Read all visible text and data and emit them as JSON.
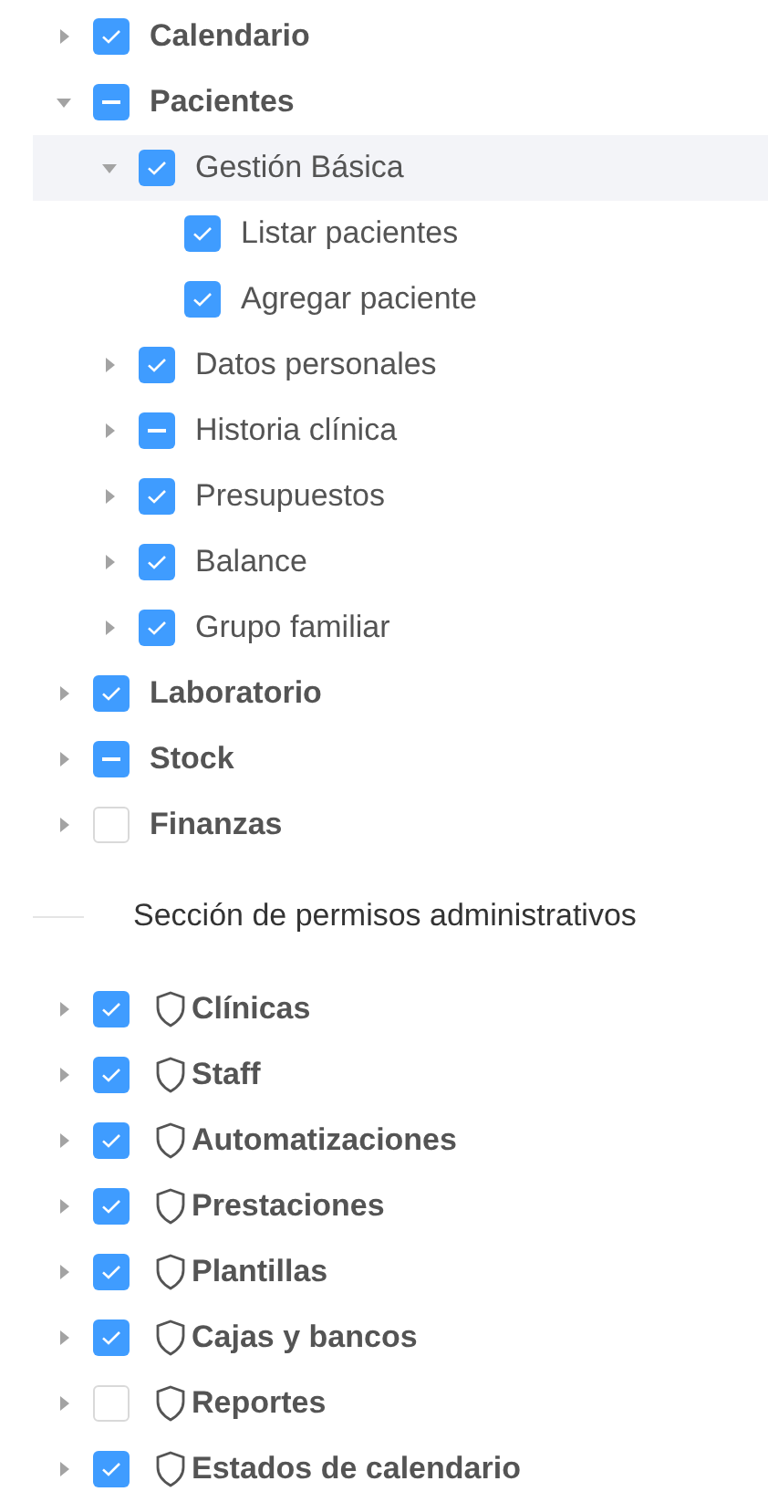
{
  "tree": [
    {
      "label": "Calendario",
      "checked": true,
      "partial": false,
      "expanded": false,
      "selected": false
    },
    {
      "label": "Pacientes",
      "checked": true,
      "partial": true,
      "expanded": true,
      "selected": false,
      "children": [
        {
          "label": "Gestión Básica",
          "checked": true,
          "partial": false,
          "expanded": true,
          "selected": true,
          "children": [
            {
              "label": "Listar pacientes",
              "checked": true,
              "partial": false,
              "selected": false
            },
            {
              "label": "Agregar paciente",
              "checked": true,
              "partial": false,
              "selected": false
            }
          ]
        },
        {
          "label": "Datos personales",
          "checked": true,
          "partial": false,
          "expanded": false,
          "selected": false
        },
        {
          "label": "Historia clínica",
          "checked": true,
          "partial": true,
          "expanded": false,
          "selected": false
        },
        {
          "label": "Presupuestos",
          "checked": true,
          "partial": false,
          "expanded": false,
          "selected": false
        },
        {
          "label": "Balance",
          "checked": true,
          "partial": false,
          "expanded": false,
          "selected": false
        },
        {
          "label": "Grupo familiar",
          "checked": true,
          "partial": false,
          "expanded": false,
          "selected": false
        }
      ]
    },
    {
      "label": "Laboratorio",
      "checked": true,
      "partial": false,
      "expanded": false,
      "selected": false
    },
    {
      "label": "Stock",
      "checked": true,
      "partial": true,
      "expanded": false,
      "selected": false
    },
    {
      "label": "Finanzas",
      "checked": false,
      "partial": false,
      "expanded": false,
      "selected": false
    }
  ],
  "admin_section": {
    "title": "Sección de permisos administrativos",
    "items": [
      {
        "label": "Clínicas",
        "checked": true,
        "expanded": false
      },
      {
        "label": "Staff",
        "checked": true,
        "expanded": false
      },
      {
        "label": "Automatizaciones",
        "checked": true,
        "expanded": false
      },
      {
        "label": "Prestaciones",
        "checked": true,
        "expanded": false
      },
      {
        "label": "Plantillas",
        "checked": true,
        "expanded": false
      },
      {
        "label": "Cajas y bancos",
        "checked": true,
        "expanded": false
      },
      {
        "label": "Reportes",
        "checked": false,
        "expanded": false
      },
      {
        "label": "Estados de calendario",
        "checked": true,
        "expanded": false
      }
    ]
  }
}
